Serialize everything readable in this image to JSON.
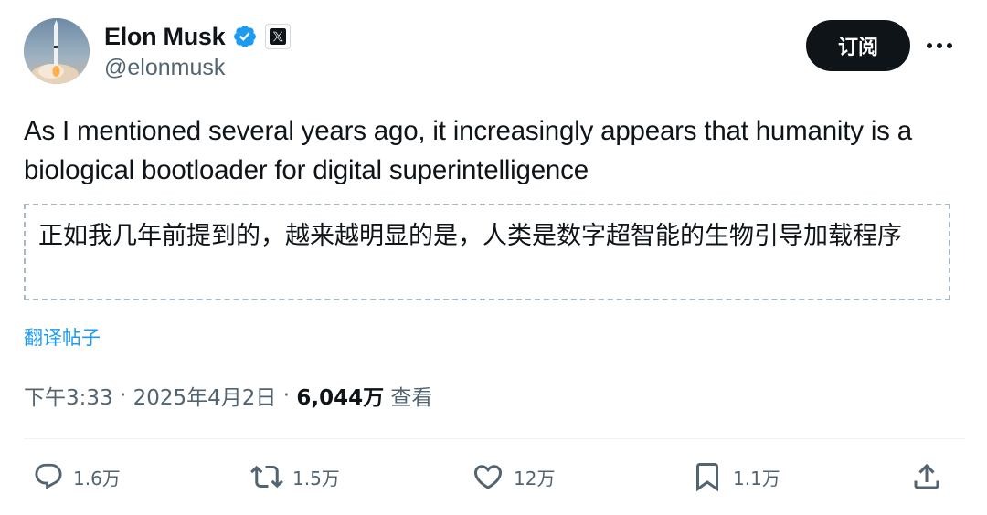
{
  "author": {
    "display_name": "Elon Musk",
    "handle": "@elonmusk",
    "verified": true,
    "affiliate_badge": "x-logo-icon"
  },
  "header": {
    "follow_label": "订阅",
    "more_icon": "more-horizontal-icon"
  },
  "tweet": {
    "text": "As I mentioned several years ago, it increasingly appears that humanity is a biological bootloader for digital superintelligence",
    "translation": "正如我几年前提到的，越来越明显的是，人类是数字超智能的生物引导加载程序",
    "translate_link": "翻译帖子"
  },
  "meta": {
    "time": "下午3:33",
    "separator1": " · ",
    "date": "2025年4月2日",
    "separator2": " · ",
    "views": "6,044万",
    "views_label": " 查看"
  },
  "actions": {
    "replies": "1.6万",
    "reposts": "1.5万",
    "likes": "12万",
    "bookmarks": "1.1万"
  },
  "colors": {
    "accent": "#1d9bf0",
    "text_primary": "#0f1419",
    "text_secondary": "#536471",
    "button_bg": "#0f1419"
  }
}
